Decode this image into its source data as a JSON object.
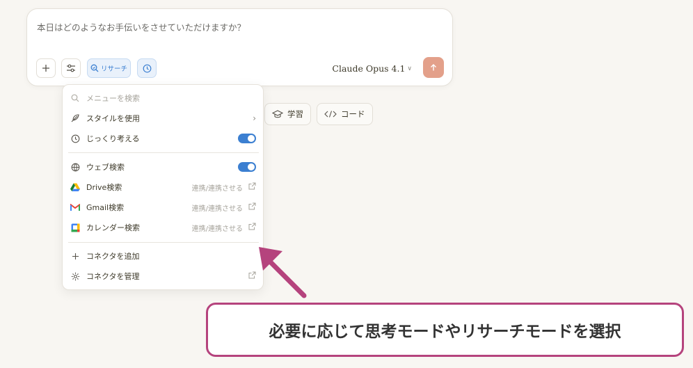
{
  "composer": {
    "placeholder": "本日はどのようなお手伝いをさせていただけますか？",
    "research_label": "リサーチ",
    "model": "Claude Opus 4.1"
  },
  "chips": [
    {
      "label": "学習",
      "icon": "graduation-cap-icon"
    },
    {
      "label": "コード",
      "icon": "code-icon"
    }
  ],
  "menu": {
    "search_placeholder": "メニューを検索",
    "items": [
      {
        "label": "スタイルを使用",
        "icon": "feather-icon"
      },
      {
        "label": "じっくり考える",
        "icon": "clock-icon",
        "enabled": true
      },
      {
        "label": "ウェブ検索",
        "icon": "globe-icon",
        "enabled": true
      },
      {
        "label": "Drive検索",
        "icon": "google-drive-icon",
        "note": "連携/連携させる"
      },
      {
        "label": "Gmail検索",
        "icon": "gmail-icon",
        "note": "連携/連携させる"
      },
      {
        "label": "カレンダー検索",
        "icon": "google-calendar-icon",
        "note": "連携/連携させる"
      },
      {
        "label": "コネクタを追加",
        "icon": "plus-icon"
      },
      {
        "label": "コネクタを管理",
        "icon": "gear-icon"
      }
    ]
  },
  "annotation": {
    "text": "必要に応じて思考モードやリサーチモードを選択"
  },
  "colors": {
    "accent_blue": "#3b7fd1",
    "send_button": "#e3a08a",
    "callout_border": "#b5437d"
  }
}
